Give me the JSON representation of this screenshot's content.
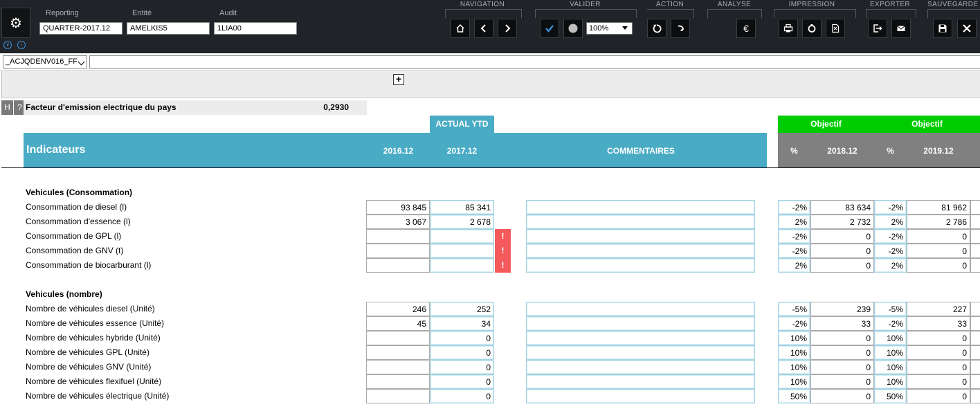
{
  "toolbar": {
    "context": {
      "reporting_label": "Reporting",
      "reporting_value": "QUARTER-2017.12",
      "entite_label": "Entité",
      "entite_value": "AMELKIS5",
      "audit_label": "Audit",
      "audit_value": "1LIA00"
    },
    "groups": {
      "navigation": "NAVIGATION",
      "valider": "VALIDER",
      "action": "ACTION",
      "analyse": "ANALYSE",
      "impression": "IMPRESSION",
      "exporter": "EXPORTER",
      "sauvegarder": "SAUVEGARDE"
    },
    "zoom": "100%",
    "icons": [
      "gear-icon",
      "home-icon",
      "prev-icon",
      "next-icon",
      "check-icon",
      "circle-icon",
      "undo-icon",
      "redo-icon",
      "euro-icon",
      "print-icon",
      "recycle-icon",
      "pdf-icon",
      "export-icon",
      "mail-icon",
      "save-icon",
      "close-icon"
    ]
  },
  "sheet": {
    "selected": "_ACJQDENV016_FF",
    "expand_label": "+",
    "h_button": "H",
    "help_button": "?",
    "factor_label": "Facteur d'emission electrique du pays",
    "factor_value": "0,2930"
  },
  "header": {
    "actual_ytd": "ACTUAL YTD",
    "title": "Indicateurs",
    "col_2016": "2016.12",
    "col_2017": "2017.12",
    "commentaires": "COMMENTAIRES",
    "objectif1": "Objectif",
    "objectif2": "Objectif",
    "pct1": "%",
    "col_2018": "2018.12",
    "pct2": "%",
    "col_2019": "2019.12"
  },
  "sections": [
    {
      "title": "Vehicules (Consommation)",
      "rows": [
        {
          "label": "Consommation de diesel (l)",
          "y2016": "93 845",
          "y2017": "85 341",
          "warn": "",
          "pct18": "-2%",
          "y2018": "83 634",
          "pct19": "-2%",
          "y2019": "81 962"
        },
        {
          "label": "Consommation d'essence (l)",
          "y2016": "3 067",
          "y2017": "2 678",
          "warn": "",
          "pct18": "2%",
          "y2018": "2 732",
          "pct19": "2%",
          "y2019": "2 786"
        },
        {
          "label": "Consommation de GPL (l)",
          "y2016": "",
          "y2017": "",
          "warn": "!",
          "pct18": "-2%",
          "y2018": "0",
          "pct19": "-2%",
          "y2019": "0"
        },
        {
          "label": "Consommation de GNV (t)",
          "y2016": "",
          "y2017": "",
          "warn": "!",
          "pct18": "-2%",
          "y2018": "0",
          "pct19": "-2%",
          "y2019": "0"
        },
        {
          "label": "Consommation de biocarburant (l)",
          "y2016": "",
          "y2017": "",
          "warn": "!",
          "pct18": "2%",
          "y2018": "0",
          "pct19": "2%",
          "y2019": "0"
        }
      ]
    },
    {
      "title": "Vehicules (nombre)",
      "rows": [
        {
          "label": "Nombre de véhicules diesel (Unité)",
          "y2016": "246",
          "y2017": "252",
          "warn": "",
          "pct18": "-5%",
          "y2018": "239",
          "pct19": "-5%",
          "y2019": "227"
        },
        {
          "label": "Nombre de véhicules essence (Unité)",
          "y2016": "45",
          "y2017": "34",
          "warn": "",
          "pct18": "-2%",
          "y2018": "33",
          "pct19": "-2%",
          "y2019": "33"
        },
        {
          "label": "Nombre de véhicules hybride (Unité)",
          "y2016": "",
          "y2017": "0",
          "warn": "",
          "pct18": "10%",
          "y2018": "0",
          "pct19": "10%",
          "y2019": "0"
        },
        {
          "label": "Nombre de véhicules GPL (Unité)",
          "y2016": "",
          "y2017": "0",
          "warn": "",
          "pct18": "10%",
          "y2018": "0",
          "pct19": "10%",
          "y2019": "0"
        },
        {
          "label": "Nombre de véhicules GNV (Unité)",
          "y2016": "",
          "y2017": "0",
          "warn": "",
          "pct18": "10%",
          "y2018": "0",
          "pct19": "10%",
          "y2019": "0"
        },
        {
          "label": "Nombre de véhicules flexifuel (Unité)",
          "y2016": "",
          "y2017": "0",
          "warn": "",
          "pct18": "10%",
          "y2018": "0",
          "pct19": "10%",
          "y2019": "0"
        },
        {
          "label": "Nombre de véhicules électrique (Unité)",
          "y2016": "",
          "y2017": "0",
          "warn": "",
          "pct18": "50%",
          "y2018": "0",
          "pct19": "50%",
          "y2019": "0"
        }
      ]
    }
  ]
}
